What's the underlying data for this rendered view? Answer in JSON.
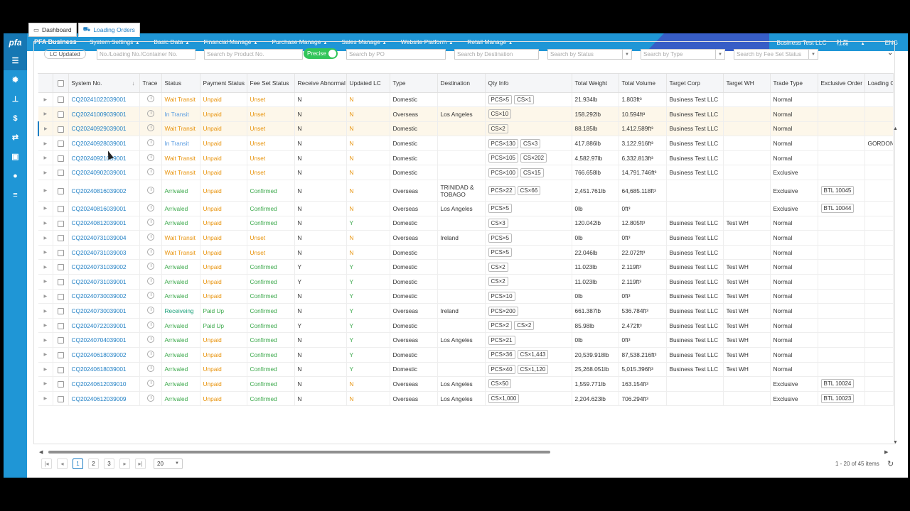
{
  "topbar": {
    "logo": "pfa",
    "brand": "PFA Business",
    "menu": [
      "System Settings",
      "Basic Data",
      "Financial Manage",
      "Purchase Manage",
      "Sales Manage",
      "Website Platform",
      "Retail Manage"
    ],
    "company": "Business Test LLC",
    "user": "杜磊",
    "lang": "ENG"
  },
  "sidebar": {
    "icons": [
      "list-icon",
      "gear-icon",
      "org-chart-icon",
      "dollar-icon",
      "exchange-icon",
      "money-icon",
      "globe-icon",
      "menu-icon"
    ],
    "glyphs": [
      "☰",
      "✹",
      "⊥",
      "$",
      "⇄",
      "▣",
      "●",
      "≡"
    ]
  },
  "tabs": [
    {
      "label": "Dashboard",
      "icon": "▭"
    },
    {
      "label": "Loading Orders",
      "icon": "⛟"
    }
  ],
  "filters": {
    "lc_updated": "LC Updated",
    "search_no": "No./Loading No./Container No.",
    "search_product": "Search by Product No.",
    "precise": "Precise",
    "search_po": "Search by PO",
    "search_destination": "Search by Destination",
    "search_status": "Search by Status",
    "search_type": "Search by Type",
    "search_fee": "Search by Fee Set Status",
    "expand_icon": "⌄"
  },
  "table": {
    "columns": [
      "System No.",
      "Trace",
      "Status",
      "Payment Status",
      "Fee Set Status",
      "Receive Abnormal",
      "Updated LC",
      "Type",
      "Destination",
      "Qty Info",
      "Total Weight",
      "Total Volume",
      "Target Corp",
      "Target WH",
      "Trade Type",
      "Exclusive Order",
      "Loading Or"
    ],
    "sort_icon": "↓",
    "rows": [
      {
        "no": "CQ20241022039001",
        "status": "Wait Transit",
        "pay": "Unpaid",
        "fee": "Unset",
        "abn": "N",
        "lc": "N",
        "type": "Domestic",
        "dest": "",
        "qty": [
          "PCS×5",
          "CS×1"
        ],
        "weight": "21.934lb",
        "volume": "1.803ft³",
        "corp": "Business Test LLC",
        "wh": "",
        "trade": "Normal",
        "excl": "",
        "load": ""
      },
      {
        "no": "CQ20241009039001",
        "status": "In Transit",
        "pay": "Unpaid",
        "fee": "Unset",
        "abn": "N",
        "lc": "N",
        "type": "Overseas",
        "dest": "Los Angeles",
        "qty": [
          "CS×10"
        ],
        "weight": "158.292lb",
        "volume": "10.594ft³",
        "corp": "Business Test LLC",
        "wh": "",
        "trade": "Normal",
        "excl": "",
        "load": ""
      },
      {
        "no": "CQ20240929039001",
        "status": "Wait Transit",
        "pay": "Unpaid",
        "fee": "Unset",
        "abn": "N",
        "lc": "N",
        "type": "Domestic",
        "dest": "",
        "qty": [
          "CS×2"
        ],
        "weight": "88.185lb",
        "volume": "1,412.589ft³",
        "corp": "Business Test LLC",
        "wh": "",
        "trade": "Normal",
        "excl": "",
        "load": ""
      },
      {
        "no": "CQ20240928039001",
        "status": "In Transit",
        "pay": "Unpaid",
        "fee": "Unset",
        "abn": "N",
        "lc": "N",
        "type": "Domestic",
        "dest": "",
        "qty": [
          "PCS×130",
          "CS×3"
        ],
        "weight": "417.886lb",
        "volume": "3,122.916ft³",
        "corp": "Business Test LLC",
        "wh": "",
        "trade": "Normal",
        "excl": "",
        "load": "GORDON"
      },
      {
        "no": "CQ20240921039001",
        "status": "Wait Transit",
        "pay": "Unpaid",
        "fee": "Unset",
        "abn": "N",
        "lc": "N",
        "type": "Domestic",
        "dest": "",
        "qty": [
          "PCS×105",
          "CS×202"
        ],
        "weight": "4,582.97lb",
        "volume": "6,332.813ft³",
        "corp": "Business Test LLC",
        "wh": "",
        "trade": "Normal",
        "excl": "",
        "load": ""
      },
      {
        "no": "CQ20240902039001",
        "status": "Wait Transit",
        "pay": "Unpaid",
        "fee": "Unset",
        "abn": "N",
        "lc": "N",
        "type": "Domestic",
        "dest": "",
        "qty": [
          "PCS×100",
          "CS×15"
        ],
        "weight": "766.658lb",
        "volume": "14,791.746ft³",
        "corp": "Business Test LLC",
        "wh": "",
        "trade": "Exclusive",
        "excl": "",
        "load": ""
      },
      {
        "no": "CQ20240816039002",
        "status": "Arrivaled",
        "pay": "Unpaid",
        "fee": "Confirmed",
        "abn": "N",
        "lc": "N",
        "type": "Overseas",
        "dest": "TRINIDAD & TOBAGO",
        "qty": [
          "PCS×22",
          "CS×66"
        ],
        "weight": "2,451.761lb",
        "volume": "64,685.118ft³",
        "corp": "",
        "wh": "",
        "trade": "Exclusive",
        "excl": "BTL 10045",
        "load": ""
      },
      {
        "no": "CQ20240816039001",
        "status": "Arrivaled",
        "pay": "Unpaid",
        "fee": "Confirmed",
        "abn": "N",
        "lc": "N",
        "type": "Overseas",
        "dest": "Los Angeles",
        "qty": [
          "PCS×5"
        ],
        "weight": "0lb",
        "volume": "0ft³",
        "corp": "",
        "wh": "",
        "trade": "Exclusive",
        "excl": "BTL 10044",
        "load": ""
      },
      {
        "no": "CQ20240812039001",
        "status": "Arrivaled",
        "pay": "Unpaid",
        "fee": "Confirmed",
        "abn": "N",
        "lc": "Y",
        "type": "Domestic",
        "dest": "",
        "qty": [
          "CS×3"
        ],
        "weight": "120.042lb",
        "volume": "12.805ft³",
        "corp": "Business Test LLC",
        "wh": "Test WH",
        "trade": "Normal",
        "excl": "",
        "load": ""
      },
      {
        "no": "CQ20240731039004",
        "status": "Wait Transit",
        "pay": "Unpaid",
        "fee": "Unset",
        "abn": "N",
        "lc": "N",
        "type": "Overseas",
        "dest": "Ireland",
        "qty": [
          "PCS×5"
        ],
        "weight": "0lb",
        "volume": "0ft³",
        "corp": "Business Test LLC",
        "wh": "",
        "trade": "Normal",
        "excl": "",
        "load": ""
      },
      {
        "no": "CQ20240731039003",
        "status": "Wait Transit",
        "pay": "Unpaid",
        "fee": "Unset",
        "abn": "N",
        "lc": "N",
        "type": "Domestic",
        "dest": "",
        "qty": [
          "PCS×5"
        ],
        "weight": "22.046lb",
        "volume": "22.072ft³",
        "corp": "Business Test LLC",
        "wh": "",
        "trade": "Normal",
        "excl": "",
        "load": ""
      },
      {
        "no": "CQ20240731039002",
        "status": "Arrivaled",
        "pay": "Unpaid",
        "fee": "Confirmed",
        "abn": "Y",
        "lc": "Y",
        "type": "Domestic",
        "dest": "",
        "qty": [
          "CS×2"
        ],
        "weight": "11.023lb",
        "volume": "2.119ft³",
        "corp": "Business Test LLC",
        "wh": "Test WH",
        "trade": "Normal",
        "excl": "",
        "load": ""
      },
      {
        "no": "CQ20240731039001",
        "status": "Arrivaled",
        "pay": "Unpaid",
        "fee": "Confirmed",
        "abn": "Y",
        "lc": "Y",
        "type": "Domestic",
        "dest": "",
        "qty": [
          "CS×2"
        ],
        "weight": "11.023lb",
        "volume": "2.119ft³",
        "corp": "Business Test LLC",
        "wh": "Test WH",
        "trade": "Normal",
        "excl": "",
        "load": ""
      },
      {
        "no": "CQ20240730039002",
        "status": "Arrivaled",
        "pay": "Unpaid",
        "fee": "Confirmed",
        "abn": "N",
        "lc": "Y",
        "type": "Domestic",
        "dest": "",
        "qty": [
          "PCS×10"
        ],
        "weight": "0lb",
        "volume": "0ft³",
        "corp": "Business Test LLC",
        "wh": "Test WH",
        "trade": "Normal",
        "excl": "",
        "load": ""
      },
      {
        "no": "CQ20240730039001",
        "status": "Receiveing",
        "pay": "Paid Up",
        "fee": "Confirmed",
        "abn": "N",
        "lc": "Y",
        "type": "Overseas",
        "dest": "Ireland",
        "qty": [
          "PCS×200"
        ],
        "weight": "661.387lb",
        "volume": "536.784ft³",
        "corp": "Business Test LLC",
        "wh": "Test WH",
        "trade": "Normal",
        "excl": "",
        "load": ""
      },
      {
        "no": "CQ20240722039001",
        "status": "Arrivaled",
        "pay": "Paid Up",
        "fee": "Confirmed",
        "abn": "Y",
        "lc": "Y",
        "type": "Domestic",
        "dest": "",
        "qty": [
          "PCS×2",
          "CS×2"
        ],
        "weight": "85.98lb",
        "volume": "2.472ft³",
        "corp": "Business Test LLC",
        "wh": "Test WH",
        "trade": "Normal",
        "excl": "",
        "load": ""
      },
      {
        "no": "CQ20240704039001",
        "status": "Arrivaled",
        "pay": "Unpaid",
        "fee": "Confirmed",
        "abn": "N",
        "lc": "Y",
        "type": "Overseas",
        "dest": "Los Angeles",
        "qty": [
          "PCS×21"
        ],
        "weight": "0lb",
        "volume": "0ft³",
        "corp": "Business Test LLC",
        "wh": "Test WH",
        "trade": "Normal",
        "excl": "",
        "load": ""
      },
      {
        "no": "CQ20240618039002",
        "status": "Arrivaled",
        "pay": "Unpaid",
        "fee": "Confirmed",
        "abn": "N",
        "lc": "Y",
        "type": "Domestic",
        "dest": "",
        "qty": [
          "PCS×36",
          "CS×1,443"
        ],
        "weight": "20,539.918lb",
        "volume": "87,538.216ft³",
        "corp": "Business Test LLC",
        "wh": "Test WH",
        "trade": "Normal",
        "excl": "",
        "load": ""
      },
      {
        "no": "CQ20240618039001",
        "status": "Arrivaled",
        "pay": "Unpaid",
        "fee": "Confirmed",
        "abn": "N",
        "lc": "Y",
        "type": "Domestic",
        "dest": "",
        "qty": [
          "PCS×40",
          "CS×1,120"
        ],
        "weight": "25,268.051lb",
        "volume": "5,015.396ft³",
        "corp": "Business Test LLC",
        "wh": "Test WH",
        "trade": "Normal",
        "excl": "",
        "load": ""
      },
      {
        "no": "CQ20240612039010",
        "status": "Arrivaled",
        "pay": "Unpaid",
        "fee": "Confirmed",
        "abn": "N",
        "lc": "N",
        "type": "Overseas",
        "dest": "Los Angeles",
        "qty": [
          "CS×50"
        ],
        "weight": "1,559.771lb",
        "volume": "163.154ft³",
        "corp": "",
        "wh": "",
        "trade": "Exclusive",
        "excl": "BTL 10024",
        "load": ""
      },
      {
        "no": "CQ20240612039009",
        "status": "Arrivaled",
        "pay": "Unpaid",
        "fee": "Confirmed",
        "abn": "N",
        "lc": "N",
        "type": "Overseas",
        "dest": "Los Angeles",
        "qty": [
          "CS×1,000"
        ],
        "weight": "2,204.623lb",
        "volume": "706.294ft³",
        "corp": "",
        "wh": "",
        "trade": "Exclusive",
        "excl": "BTL 10023",
        "load": ""
      }
    ]
  },
  "pager": {
    "first": "|◂",
    "prev": "◂",
    "pages": [
      "1",
      "2",
      "3"
    ],
    "next": "▸",
    "last": "▸|",
    "size": "20",
    "summary": "1 - 20 of 45 items",
    "refresh": "↻"
  },
  "colors": {
    "primary": "#1f96d6",
    "link": "#1f7fc4",
    "orange": "#e8930b",
    "green": "#3aa84a",
    "toggle": "#32c55a"
  }
}
